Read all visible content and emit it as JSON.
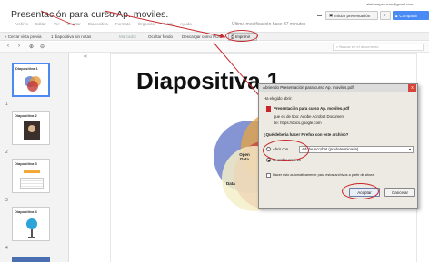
{
  "header": {
    "email": "alefomeyasusan@gmail.com",
    "doc_title": "Presentación para curso Ap. moviles.",
    "menu": [
      "Archivo",
      "Editar",
      "Ver",
      "Insertar",
      "Diapositiva",
      "Formato",
      "Organizar",
      "Tabla",
      "Ayuda"
    ],
    "last_modified": "Última modificación hace 37 minutos",
    "present_label": "Iniciar presentación",
    "comments_label": "Comentarios",
    "share_label": "Compartir",
    "colors": {
      "share": "#4a8af4",
      "annotation": "#c8262a"
    }
  },
  "toolbar": {
    "back_label": "« Cerrar vista previa",
    "slide_notes_label": "1 diapositiva sin notas",
    "options_label": "Marcador",
    "hide_label": "Ocultar fondo",
    "download_label": "Descargar como PDF",
    "print_label": "Imprimir"
  },
  "toolbar2": {
    "search_placeholder": "Buscar en el documento",
    "zoom_in": "+",
    "zoom_out": "-"
  },
  "sidebar": {
    "slides": [
      {
        "num": "1",
        "title": "Diapositiva 1",
        "thumb": "venn"
      },
      {
        "num": "2",
        "title": "Diapositiva 2",
        "thumb": "photo"
      },
      {
        "num": "3",
        "title": "Diapositiva 3",
        "thumb": "table"
      },
      {
        "num": "4",
        "title": "Diapositiva 4",
        "thumb": "lightbulb"
      }
    ],
    "next_num": "4"
  },
  "slide": {
    "heading": "Diapositiva 1",
    "venn_labels": [
      "Open Data",
      "Data"
    ]
  },
  "dialog": {
    "title": "Abriendo Presentación para curso Ap. moviles.pdf",
    "intro": "Ha elegido abrir:",
    "filename": "Presentación para curso Ap. moviles.pdf",
    "type_line": "que es de tipo: Adobe Acrobat Document",
    "from_line": "de: https://docs.google.com",
    "question": "¿Qué debería hacer Firefox con este archivo?",
    "open_with_label": "Abrir con",
    "open_with_value": "Adobe Acrobat (predeterminada)",
    "save_label": "Guardar archivo",
    "remember_label": "Hacer esto automáticamente para estos archivos a partir de ahora.",
    "accept_label": "Aceptar",
    "cancel_label": "Cancelar",
    "close_symbol": "x"
  }
}
